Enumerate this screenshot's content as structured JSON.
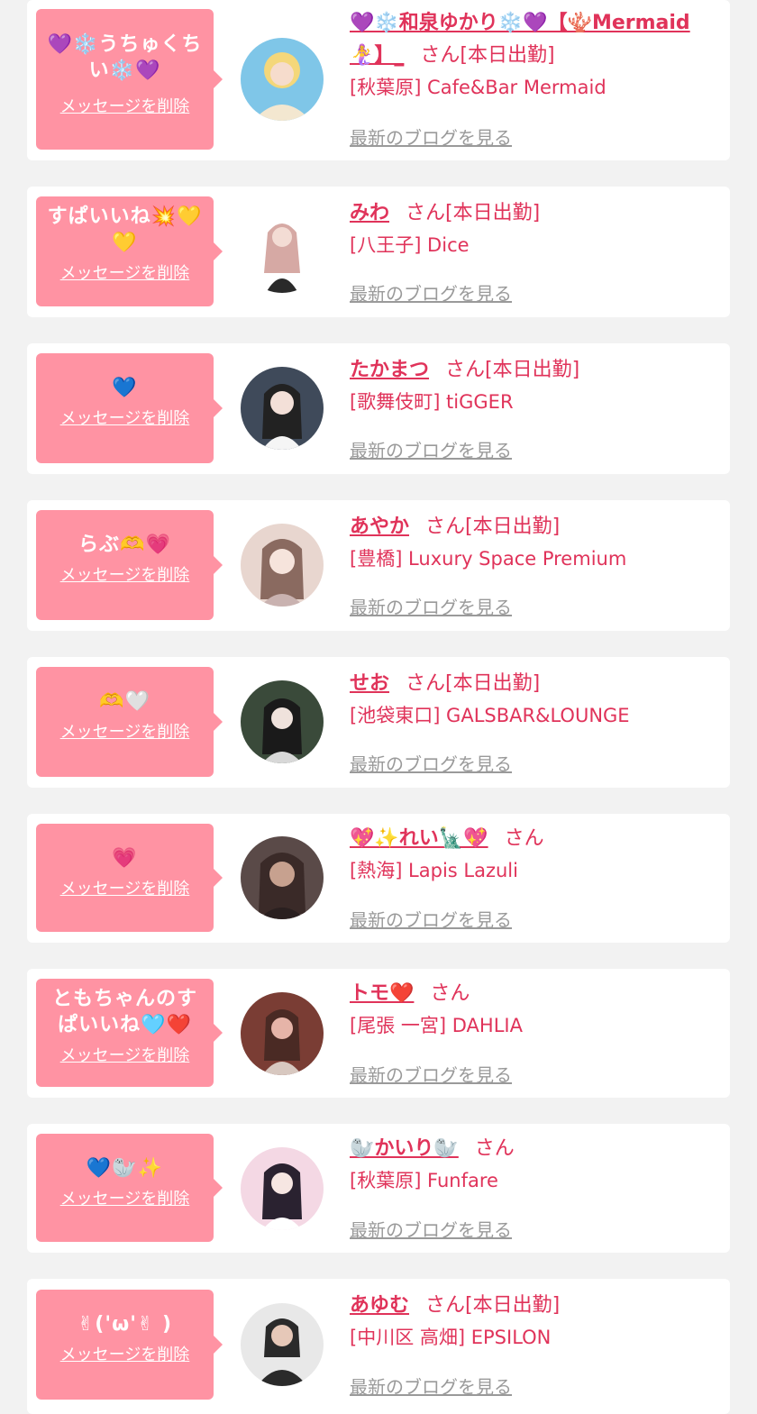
{
  "cards": [
    {
      "message": "💜❄️うちゅくちい❄️💜",
      "delete_label": "メッセージを削除",
      "name": "💜❄️和泉ゆかり❄️💜【🪸Mermaid🧜‍♀️】_",
      "honorific": "さん",
      "status": "[本日出勤]",
      "store": "[秋葉原] Cafe&Bar Mermaid",
      "blog_label": "最新のブログを見る",
      "avatar_colors": [
        "#7fc6e8",
        "#f4d77a"
      ]
    },
    {
      "message": "すぱいいね💥💛💛",
      "delete_label": "メッセージを削除",
      "name": "みわ",
      "honorific": "さん",
      "status": "[本日出勤]",
      "store": "[八王子] Dice",
      "blog_label": "最新のブログを見る",
      "avatar_colors": [
        "#ffffff",
        "#d6a9a4"
      ]
    },
    {
      "message": "💙",
      "delete_label": "メッセージを削除",
      "name": "たかまつ",
      "honorific": "さん",
      "status": "[本日出勤]",
      "store": "[歌舞伎町] tiGGER",
      "blog_label": "最新のブログを見る",
      "avatar_colors": [
        "#3f4a5a",
        "#222222"
      ]
    },
    {
      "message": "らぶ🫶💗",
      "delete_label": "メッセージを削除",
      "name": "あやか",
      "honorific": "さん",
      "status": "[本日出勤]",
      "store": "[豊橋] Luxury Space Premium",
      "blog_label": "最新のブログを見る",
      "avatar_colors": [
        "#e8d6cf",
        "#8a6a60"
      ]
    },
    {
      "message": "🫶🤍",
      "delete_label": "メッセージを削除",
      "name": "せお",
      "honorific": "さん",
      "status": "[本日出勤]",
      "store": "[池袋東口] GALSBAR&LOUNGE",
      "blog_label": "最新のブログを見る",
      "avatar_colors": [
        "#3a4a3a",
        "#1a1a1a"
      ]
    },
    {
      "message": "💗",
      "delete_label": "メッセージを削除",
      "name": "💖✨れい🗽💖",
      "honorific": "さん",
      "status": "",
      "store": "[熱海] Lapis Lazuli",
      "blog_label": "最新のブログを見る",
      "avatar_colors": [
        "#5a4a48",
        "#c7a18f"
      ]
    },
    {
      "message": "ともちゃんのすぱいいね🩵❤️",
      "delete_label": "メッセージを削除",
      "name": "トモ❤️",
      "honorific": "さん",
      "status": "",
      "store": "[尾張 一宮] DAHLIA",
      "blog_label": "最新のブログを見る",
      "avatar_colors": [
        "#7a3d34",
        "#e6b4a8"
      ]
    },
    {
      "message": "💙🦭✨",
      "delete_label": "メッセージを削除",
      "name": "🦭かいり🦭",
      "honorific": "さん",
      "status": "",
      "store": "[秋葉原] Funfare",
      "blog_label": "最新のブログを見る",
      "avatar_colors": [
        "#f4d8e4",
        "#2a2230"
      ]
    },
    {
      "message": "✌︎('ω'✌︎ )",
      "delete_label": "メッセージを削除",
      "name": "あゆむ",
      "honorific": "さん",
      "status": "[本日出勤]",
      "store": "[中川区 高畑] EPSILON",
      "blog_label": "最新のブログを見る",
      "avatar_colors": [
        "#e8e8e8",
        "#2a2a2a"
      ]
    }
  ]
}
